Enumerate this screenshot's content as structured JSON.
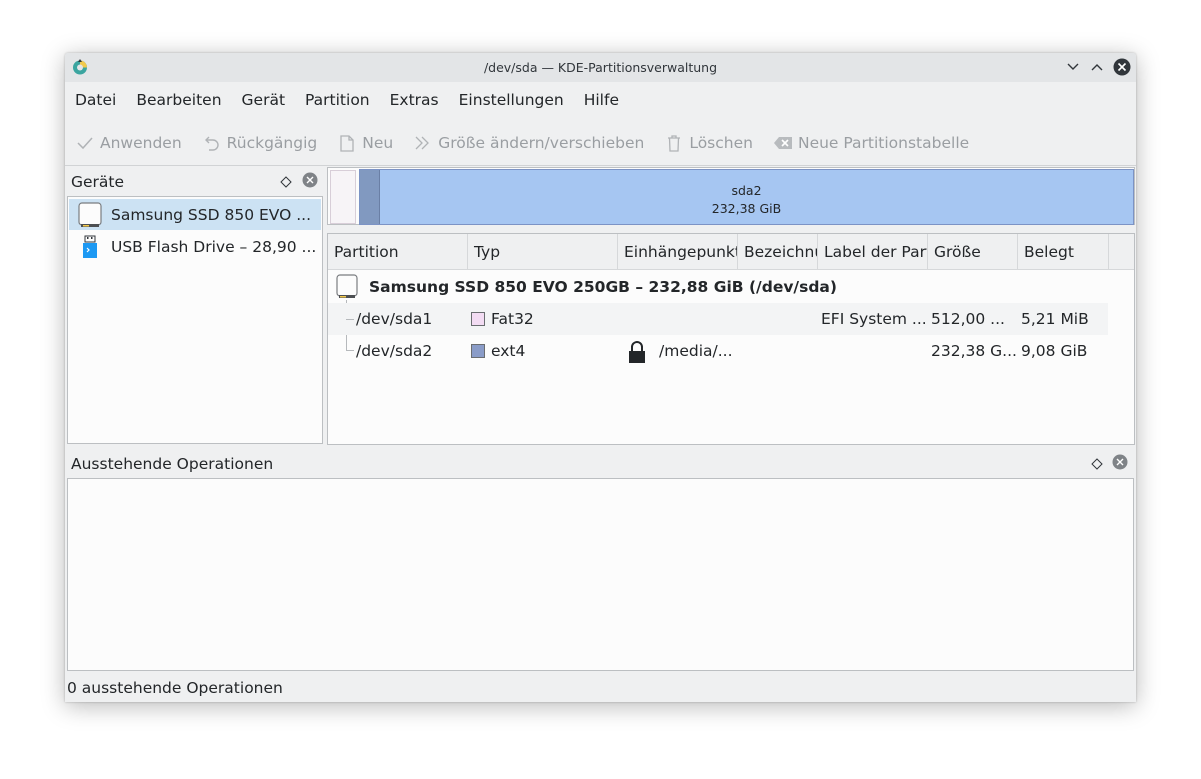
{
  "window": {
    "title": "/dev/sda — KDE-Partitionsverwaltung"
  },
  "menu": [
    "Datei",
    "Bearbeiten",
    "Gerät",
    "Partition",
    "Extras",
    "Einstellungen",
    "Hilfe"
  ],
  "toolbar": {
    "apply": "Anwenden",
    "undo": "Rückgängig",
    "new": "Neu",
    "resize": "Größe ändern/verschieben",
    "delete": "Löschen",
    "new_table": "Neue Partitionstabelle"
  },
  "devices": {
    "title": "Geräte",
    "items": [
      {
        "label": "Samsung SSD 850 EVO ...",
        "icon": "drive-harddisk-icon",
        "selected": true
      },
      {
        "label": "USB Flash Drive – 28,90 ...",
        "icon": "drive-removable-media-usb-icon",
        "selected": false
      }
    ]
  },
  "partition_bar": {
    "sda2_name": "sda2",
    "sda2_size": "232,38 GiB",
    "colors": {
      "fat32": "#f3dcf3",
      "ext4": "#a6c6f2",
      "ext4_used": "#8199c0"
    }
  },
  "table": {
    "headers": [
      "Partition",
      "Typ",
      "Einhängepunkt",
      "Bezeichnung",
      "Label der Partition",
      "Größe",
      "Belegt"
    ],
    "disk_label": "Samsung SSD 850 EVO 250GB – 232,88 GiB (/dev/sda)",
    "rows": [
      {
        "partition": "/dev/sda1",
        "type": "Fat32",
        "type_color": "#f3dcf3",
        "mount": "",
        "locked": false,
        "label": "",
        "partlabel": "EFI System ...",
        "size": "512,00 ...",
        "used": "5,21 MiB"
      },
      {
        "partition": "/dev/sda2",
        "type": "ext4",
        "type_color": "#8a9cc8",
        "mount": "/media/...",
        "locked": true,
        "label": "",
        "partlabel": "",
        "size": "232,38 G...",
        "used": "9,08 GiB"
      }
    ]
  },
  "pending": {
    "title": "Ausstehende Operationen"
  },
  "status": "0 ausstehende Operationen"
}
